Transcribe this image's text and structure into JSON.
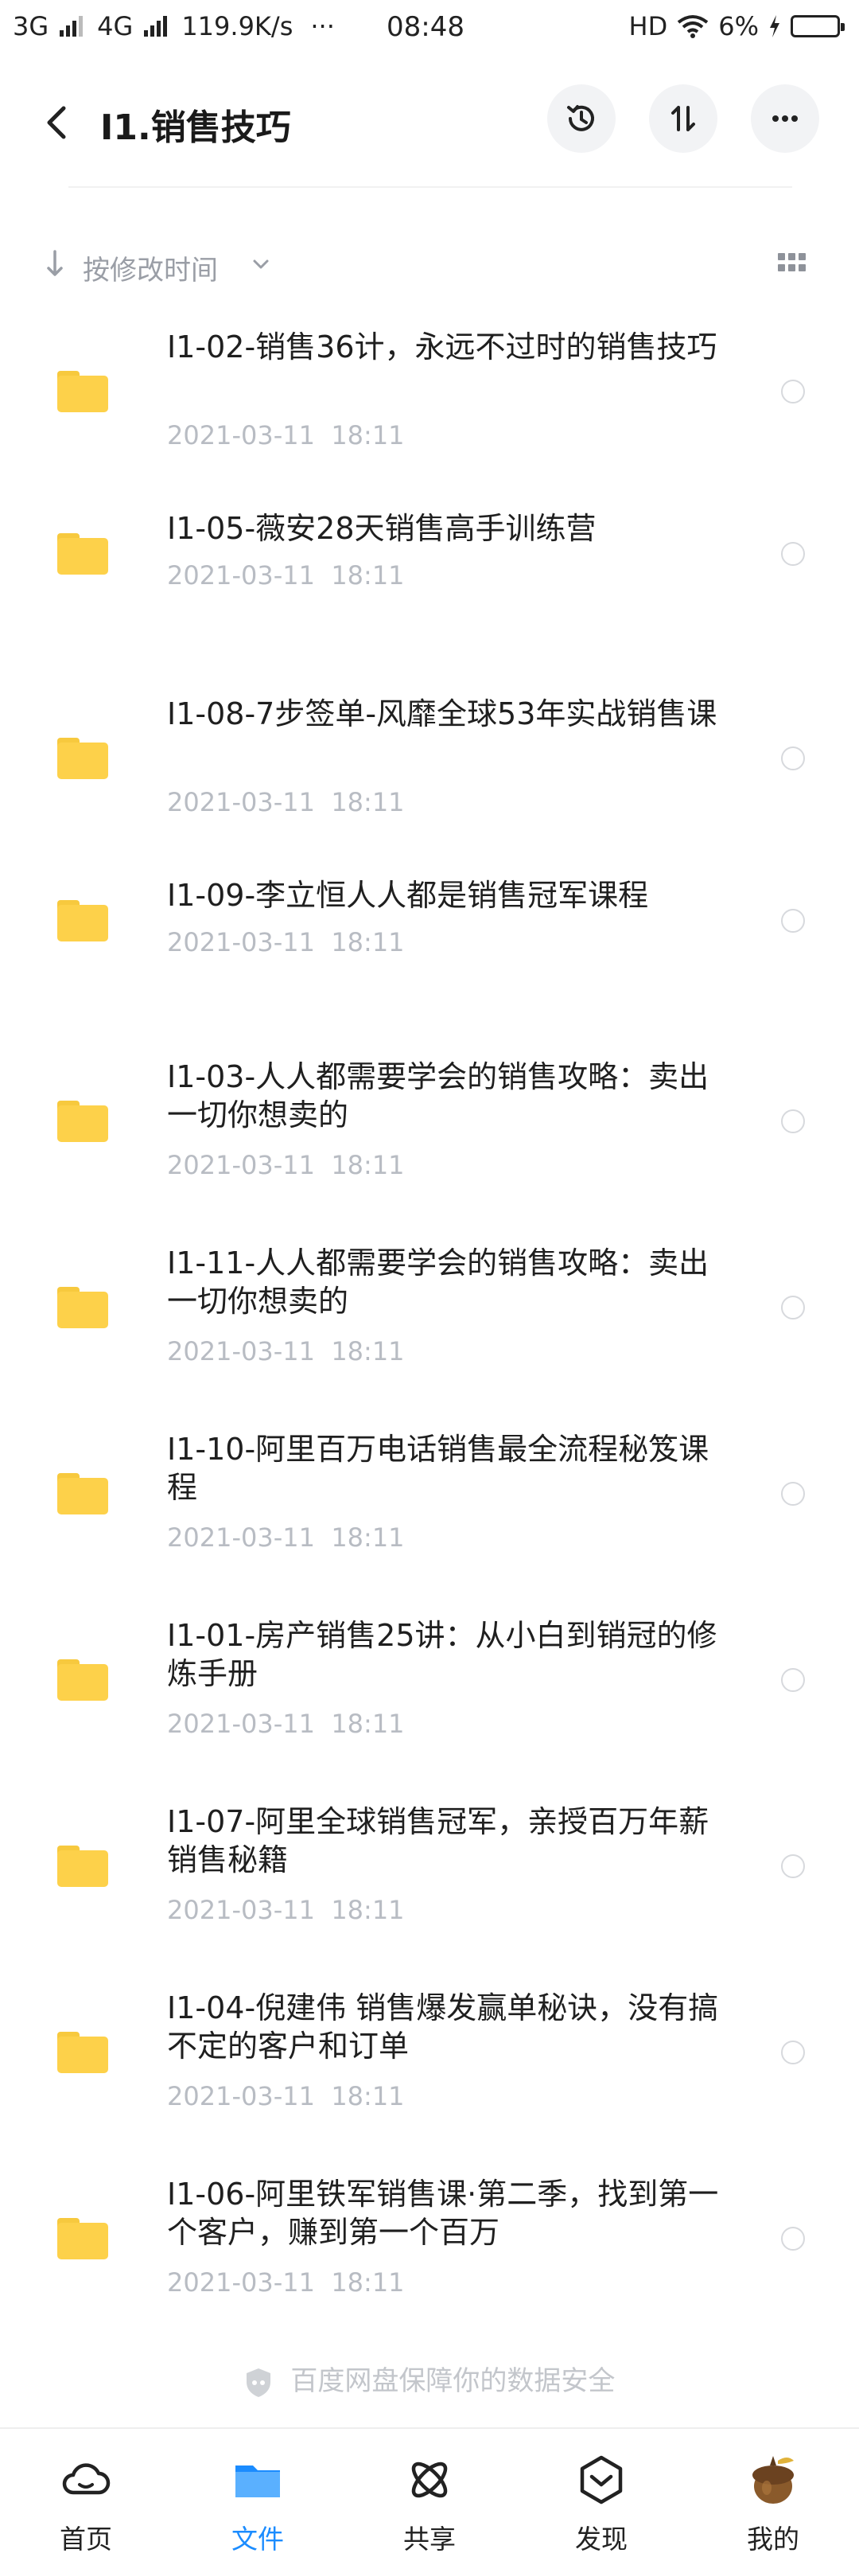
{
  "status_bar": {
    "net1": "3G",
    "net2": "4G",
    "speed": "119.9K/s",
    "dots": "···",
    "time": "08:48",
    "hd": "HD",
    "battery": "6%"
  },
  "header": {
    "title": "I1.销售技巧"
  },
  "sort": {
    "label": "按修改时间"
  },
  "files": [
    {
      "name": "I1-02-销售36计，永远不过时的销售技巧",
      "date": "2021-03-11  18:11"
    },
    {
      "name": "I1-05-薇安28天销售高手训练营",
      "date": "2021-03-11  18:11"
    },
    {
      "name": "I1-08-7步签单-风靡全球53年实战销售课",
      "date": "2021-03-11  18:11"
    },
    {
      "name": "I1-09-李立恒人人都是销售冠军课程",
      "date": "2021-03-11  18:11"
    },
    {
      "name": "I1-03-人人都需要学会的销售攻略：卖出一切你想卖的",
      "date": "2021-03-11  18:11"
    },
    {
      "name": "I1-11-人人都需要学会的销售攻略：卖出一切你想卖的",
      "date": "2021-03-11  18:11"
    },
    {
      "name": "I1-10-阿里百万电话销售最全流程秘笈课程",
      "date": "2021-03-11  18:11"
    },
    {
      "name": "I1-01-房产销售25讲：从小白到销冠的修炼手册",
      "date": "2021-03-11  18:11"
    },
    {
      "name": "I1-07-阿里全球销售冠军，亲授百万年薪销售秘籍",
      "date": "2021-03-11  18:11"
    },
    {
      "name": "I1-04-倪建伟 销售爆发赢单秘诀，没有搞不定的客户和订单",
      "date": "2021-03-11  18:11"
    },
    {
      "name": "I1-06-阿里铁军销售课·第二季，找到第一个客户，赚到第一个百万",
      "date": "2021-03-11  18:11"
    }
  ],
  "footer_note": "百度网盘保障你的数据安全",
  "tabs": [
    {
      "label": "首页",
      "icon": "cloud-icon"
    },
    {
      "label": "文件",
      "icon": "folder-icon"
    },
    {
      "label": "共享",
      "icon": "share-atom-icon"
    },
    {
      "label": "发现",
      "icon": "discover-icon"
    },
    {
      "label": "我的",
      "icon": "avatar-icon"
    }
  ],
  "colors": {
    "accent": "#1b8cff",
    "folder": "#fdd14a",
    "date": "#b8bcc3"
  }
}
